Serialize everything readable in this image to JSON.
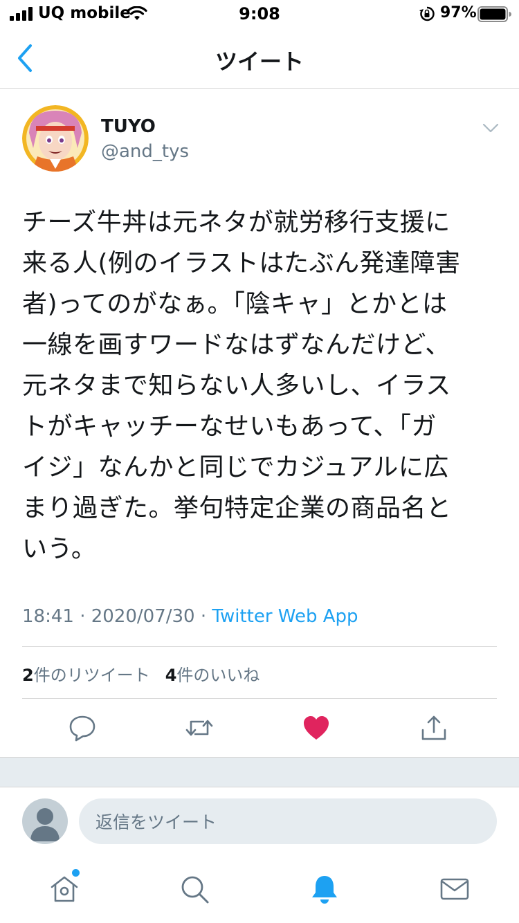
{
  "status_bar": {
    "carrier": "UQ mobile",
    "time": "9:08",
    "battery_percent": "97%"
  },
  "nav": {
    "title": "ツイート"
  },
  "tweet": {
    "author": {
      "display_name": "TUYO",
      "handle": "@and_tys"
    },
    "text_lines": [
      "チーズ牛丼は元ネタが就労移行支援に",
      "来る人(例のイラストはたぶん発達障害",
      "者)ってのがなぁ。「陰キャ」とかとは",
      "一線を画すワードなはずなんだけど、",
      "元ネタまで知らない人多いし、イラス",
      "トがキャッチーなせいもあって、「ガ",
      "イジ」なんかと同じでカジュアルに広",
      "まり過ぎた。挙句特定企業の商品名と",
      "いう。"
    ],
    "time": "18:41",
    "date": "2020/07/30",
    "separator": "·",
    "source": "Twitter Web App",
    "retweet_count": "2",
    "retweet_label": "件のリツイート",
    "like_count": "4",
    "like_label": "件のいいね",
    "liked": true
  },
  "reply": {
    "placeholder": "返信をツイート"
  },
  "colors": {
    "accent": "#1da1f2",
    "like": "#e0245e",
    "muted": "#657786"
  },
  "icons": [
    "back-chevron-icon",
    "chevron-down-icon",
    "reply-icon",
    "retweet-icon",
    "heart-icon",
    "share-icon",
    "home-icon",
    "search-icon",
    "notifications-icon",
    "messages-icon"
  ]
}
